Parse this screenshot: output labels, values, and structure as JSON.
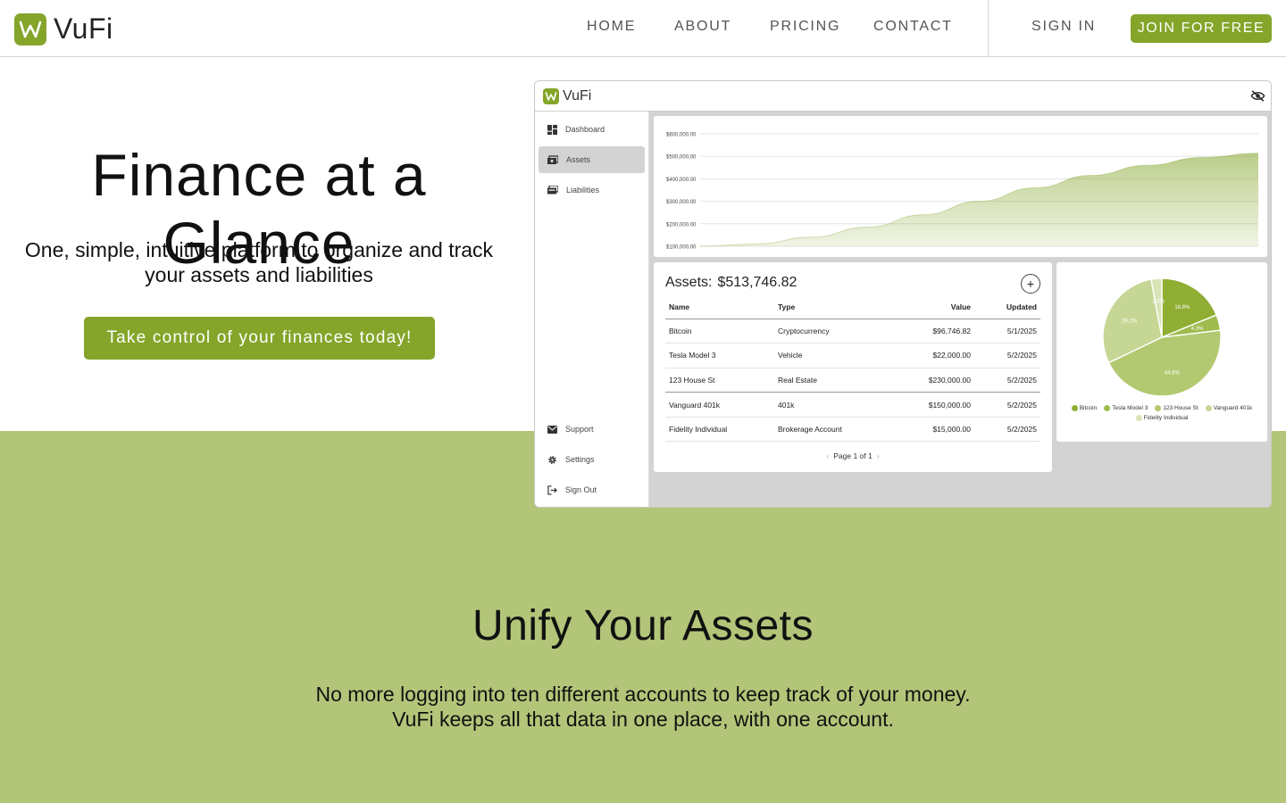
{
  "brand": {
    "name": "VuFi",
    "accent": "#84a52a",
    "band": "#b3c578"
  },
  "nav": {
    "links": [
      "HOME",
      "ABOUT",
      "PRICING",
      "CONTACT"
    ],
    "sign_in": "SIGN IN",
    "join": "JOIN FOR FREE"
  },
  "hero": {
    "title": "Finance at a Glance",
    "subtitle_line1": "One, simple, intuitive platform to organize and track",
    "subtitle_line2": "your assets and liabilities",
    "cta": "Take control of your finances today!"
  },
  "section": {
    "title": "Unify Your Assets",
    "body_line1": "No more logging into ten different accounts to keep track of your money.",
    "body_line2": "VuFi keeps all that data in one place, with one account."
  },
  "preview": {
    "logo": "VuFi",
    "icons": {
      "visibility": "eye-off-icon"
    },
    "sidebar": {
      "top": [
        {
          "label": "Dashboard",
          "icon": "dashboard-icon"
        },
        {
          "label": "Assets",
          "icon": "assets-icon",
          "active": true
        },
        {
          "label": "Liabilities",
          "icon": "liabilities-icon"
        }
      ],
      "bottom": [
        {
          "label": "Support",
          "icon": "mail-icon"
        },
        {
          "label": "Settings",
          "icon": "gear-icon"
        },
        {
          "label": "Sign Out",
          "icon": "sign-out-icon"
        }
      ]
    },
    "table": {
      "title": "Assets:",
      "total": "$513,746.82",
      "add": "+",
      "columns": [
        "Name",
        "Type",
        "Value",
        "Updated"
      ],
      "rows": [
        [
          "Bitcoin",
          "Cryptocurrency",
          "$96,746.82",
          "5/1/2025"
        ],
        [
          "Tesla Model 3",
          "Vehicle",
          "$22,000.00",
          "5/2/2025"
        ],
        [
          "123 House St",
          "Real Estate",
          "$230,000.00",
          "5/2/2025"
        ],
        [
          "Vanguard 401k",
          "401k",
          "$150,000.00",
          "5/2/2025"
        ],
        [
          "Fidelity Individual",
          "Brokerage Account",
          "$15,000.00",
          "5/2/2025"
        ]
      ],
      "pager": "Page 1 of 1"
    }
  },
  "chart_data": [
    {
      "type": "area",
      "y_ticks": [
        "$100,000.00",
        "$200,000.00",
        "$300,000.00",
        "$400,000.00",
        "$500,000.00",
        "$600,000.00"
      ],
      "ylim": [
        100000,
        600000
      ],
      "grid": true,
      "x": [
        0,
        0.1,
        0.2,
        0.3,
        0.4,
        0.5,
        0.6,
        0.7,
        0.8,
        0.9,
        1.0
      ],
      "values": [
        100000,
        110000,
        140000,
        185000,
        240000,
        300000,
        360000,
        415000,
        460000,
        495000,
        513747
      ],
      "color": "#84a52a"
    },
    {
      "type": "pie",
      "labels": [
        "Bitcoin",
        "Tesla Model 3",
        "123 House St",
        "Vanguard 401k",
        "Fidelity Individual"
      ],
      "values": [
        96746.82,
        22000,
        230000,
        150000,
        15000
      ],
      "slice_labels": [
        "18.8%",
        "4.3%",
        "44.8%",
        "29.2%",
        "2.9%"
      ],
      "colors": [
        "#8fae33",
        "#9fbb4d",
        "#b3c971",
        "#c6d695",
        "#d8e3b6"
      ],
      "legend": "bottom"
    }
  ]
}
